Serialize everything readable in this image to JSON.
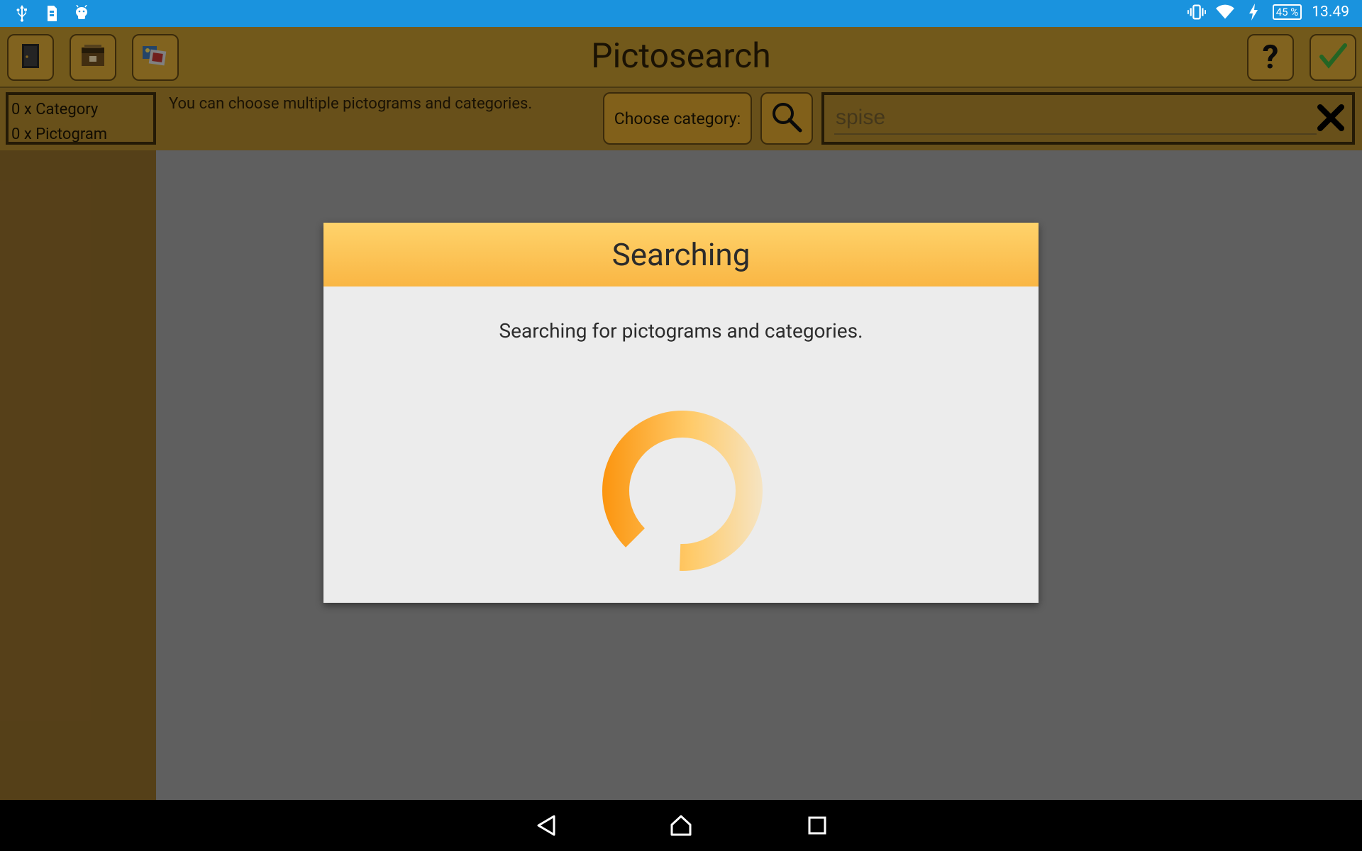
{
  "status_bar": {
    "battery": "45 %",
    "time": "13.49",
    "left_icons": [
      "usb-icon",
      "sim-icon",
      "android-icon"
    ],
    "right_icons": [
      "vibrate-icon",
      "wifi-icon",
      "charging-icon",
      "battery-icon"
    ]
  },
  "toolbar": {
    "title": "Pictosearch",
    "left_buttons": [
      "exit-icon",
      "archive-icon",
      "pictogram-gallery-icon"
    ],
    "help_label": "?",
    "accept_label": "✓"
  },
  "subbar": {
    "category_count": "0 x Category",
    "pictogram_count": "0 x Pictogram",
    "hint": "You can choose multiple pictograms and categories.",
    "choose_category": "Choose category:",
    "search_value": "spise"
  },
  "dialog": {
    "title": "Searching",
    "message": "Searching for pictograms and categories."
  },
  "colors": {
    "status_bar": "#1a93de",
    "toolbar": "#b8902c",
    "dialog_header": "#f9b644",
    "spinner": "#fb8c00",
    "accept_check": "#3aa43a"
  }
}
